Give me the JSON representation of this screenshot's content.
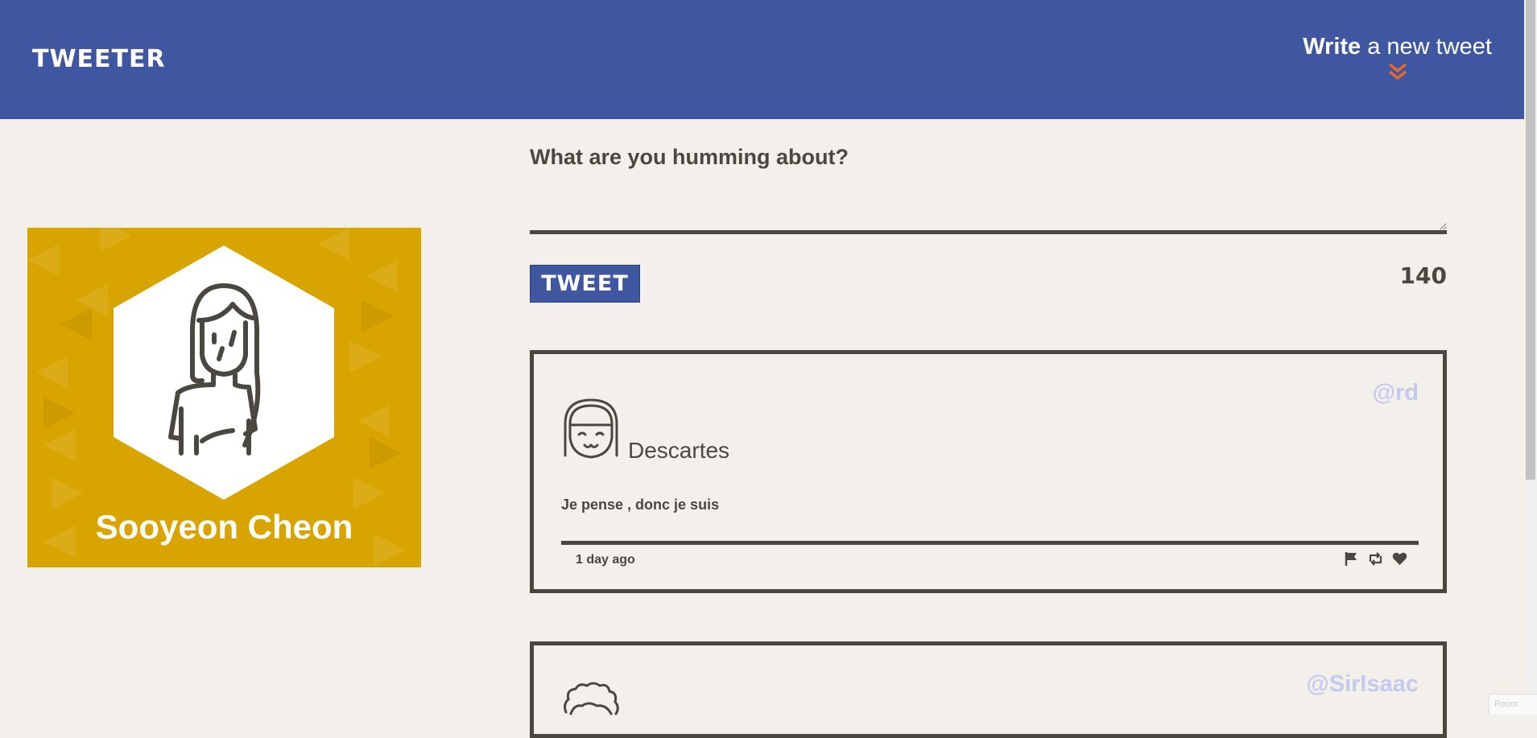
{
  "nav": {
    "brand": "TWEETER",
    "compose_bold": "Write",
    "compose_rest": " a new tweet"
  },
  "profile": {
    "name": "Sooyeon Cheon"
  },
  "compose": {
    "prompt": "What are you humming about?",
    "value": "",
    "button_label": "TWEET",
    "counter": "140"
  },
  "tweets": [
    {
      "handle": "@rd",
      "author": "Descartes",
      "text": "Je pense , donc je suis",
      "time": "1 day ago"
    },
    {
      "handle": "@SirIsaac"
    }
  ],
  "icons": {
    "compose_chevron": "double-chevron-down-icon",
    "flag": "flag-icon",
    "retweet": "retweet-icon",
    "like": "heart-icon"
  },
  "colors": {
    "nav_bg": "#3f56a1",
    "page_bg": "#f3f0ec",
    "accent": "#e8692a",
    "profile_bg": "#d8a400",
    "handle": "#c5c9ef"
  },
  "misc": {
    "corner_text": "Recor"
  }
}
